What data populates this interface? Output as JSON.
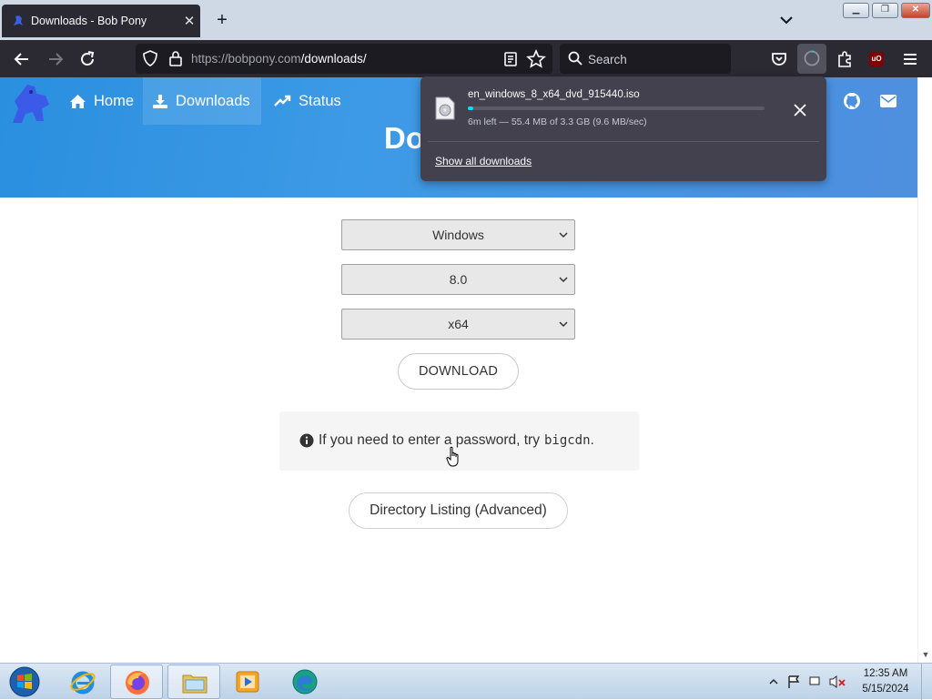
{
  "browser": {
    "tab": {
      "title": "Downloads - Bob Pony"
    },
    "url": {
      "host": "https://bobpony.com",
      "path": "/downloads/"
    },
    "search": {
      "placeholder": "Search"
    },
    "addon_badge": "uO"
  },
  "site": {
    "nav": {
      "home": "Home",
      "downloads": "Downloads",
      "status": "Status"
    },
    "hero_title": "Do",
    "selects": {
      "os": "Windows",
      "version": "8.0",
      "arch": "x64"
    },
    "download_button": "DOWNLOAD",
    "info": {
      "text": "If you need to enter a password, try",
      "code": "bigcdn",
      "period": "."
    },
    "directory_button": "Directory Listing (Advanced)"
  },
  "download_panel": {
    "filename": "en_windows_8_x64_dvd_915440.iso",
    "status": "6m left — 55.4 MB of 3.3 GB (9.6 MB/sec)",
    "progress": 0.017,
    "show_all": "Show all downloads"
  },
  "taskbar": {
    "time": "12:35 AM",
    "date": "5/15/2024"
  },
  "colors": {
    "accent": "#00ddff",
    "hero": "#3d9ae6",
    "browser_dark": "#2b2a33"
  }
}
